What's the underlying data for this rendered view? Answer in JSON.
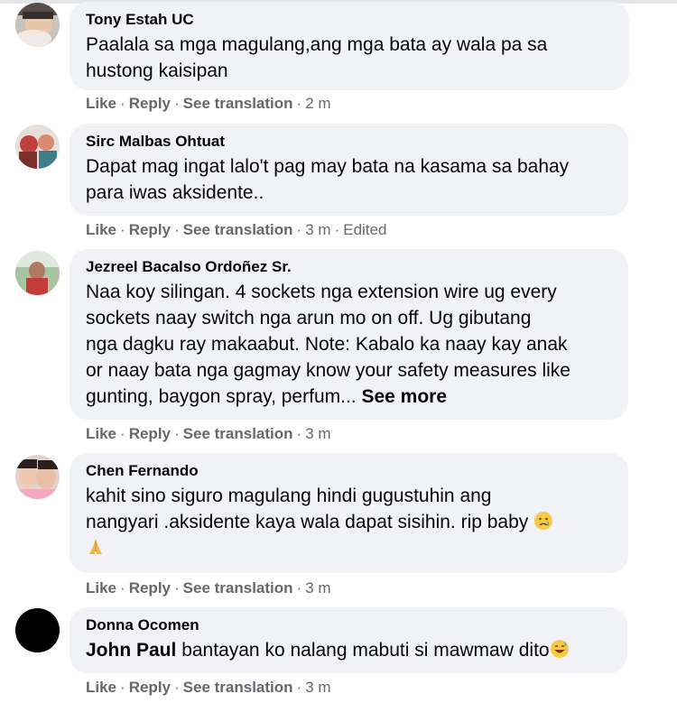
{
  "actions": {
    "like": "Like",
    "reply": "Reply",
    "translate": "See translation",
    "dot": "·"
  },
  "comments": [
    {
      "author": "Tony Estah UC",
      "lines": [
        "Paalala sa mga magulang,ang mga bata ay wala pa sa",
        "hustong kaisipan"
      ],
      "time": "2 m",
      "avatar_icon": "profile-photo"
    },
    {
      "author": "Sirc Malbas Ohtuat",
      "lines": [
        "Dapat mag ingat lalo't pag may bata na kasama sa bahay",
        "para iwas aksidente.."
      ],
      "time": "3 m",
      "edited": "Edited",
      "avatar_icon": "profile-photo"
    },
    {
      "author": "Jezreel Bacalso Ordoñez Sr.",
      "lines": [
        "Naa koy silingan. 4 sockets nga extension wire ug every",
        "sockets naay switch nga arun mo on off. Ug gibutang",
        "nga dagku ray makaabut. Note: Kabalo ka naay kay anak",
        "or naay bata nga gagmay know your safety measures like",
        "gunting, baygon spray, perfum..."
      ],
      "see_more": "See more",
      "time": "3 m",
      "avatar_icon": "profile-photo"
    },
    {
      "author": "Chen Fernando",
      "lines": [
        "kahit sino siguro magulang hindi gugustuhin ang",
        "nangyari .aksidente kaya wala dapat sisihin. rip baby"
      ],
      "emojis": [
        "crying-face-emoji",
        "folded-hands-emoji"
      ],
      "time": "3 m",
      "avatar_icon": "profile-photo"
    },
    {
      "author": "Donna Ocomen",
      "mention": "John Paul",
      "text": "bantayan ko nalang mabuti si mawmaw dito",
      "emojis": [
        "grinning-sweat-emoji"
      ],
      "time": "3 m",
      "avatar_icon": "default-avatar"
    }
  ],
  "colors": {
    "bubble": "#f0f2f5",
    "meta": "#65676b",
    "text": "#050505"
  }
}
